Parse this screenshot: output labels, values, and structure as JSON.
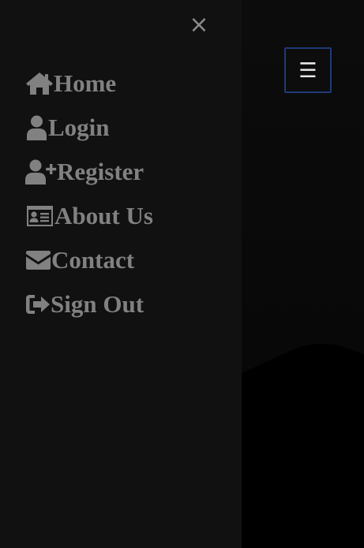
{
  "sidenav": {
    "close_glyph": "×",
    "items": [
      {
        "label": "Home",
        "icon": "home-icon"
      },
      {
        "label": "Login",
        "icon": "user-icon"
      },
      {
        "label": "Register",
        "icon": "user-plus-icon"
      },
      {
        "label": "About Us",
        "icon": "id-card-icon"
      },
      {
        "label": "Contact",
        "icon": "envelope-icon"
      },
      {
        "label": "Sign Out",
        "icon": "sign-out-icon"
      }
    ]
  },
  "header": {
    "menu_glyph": "☰"
  },
  "colors": {
    "sidenav_bg": "#111111",
    "link_text": "#818181",
    "toggle_border": "#1f3a78",
    "page_bg": "#000000"
  }
}
